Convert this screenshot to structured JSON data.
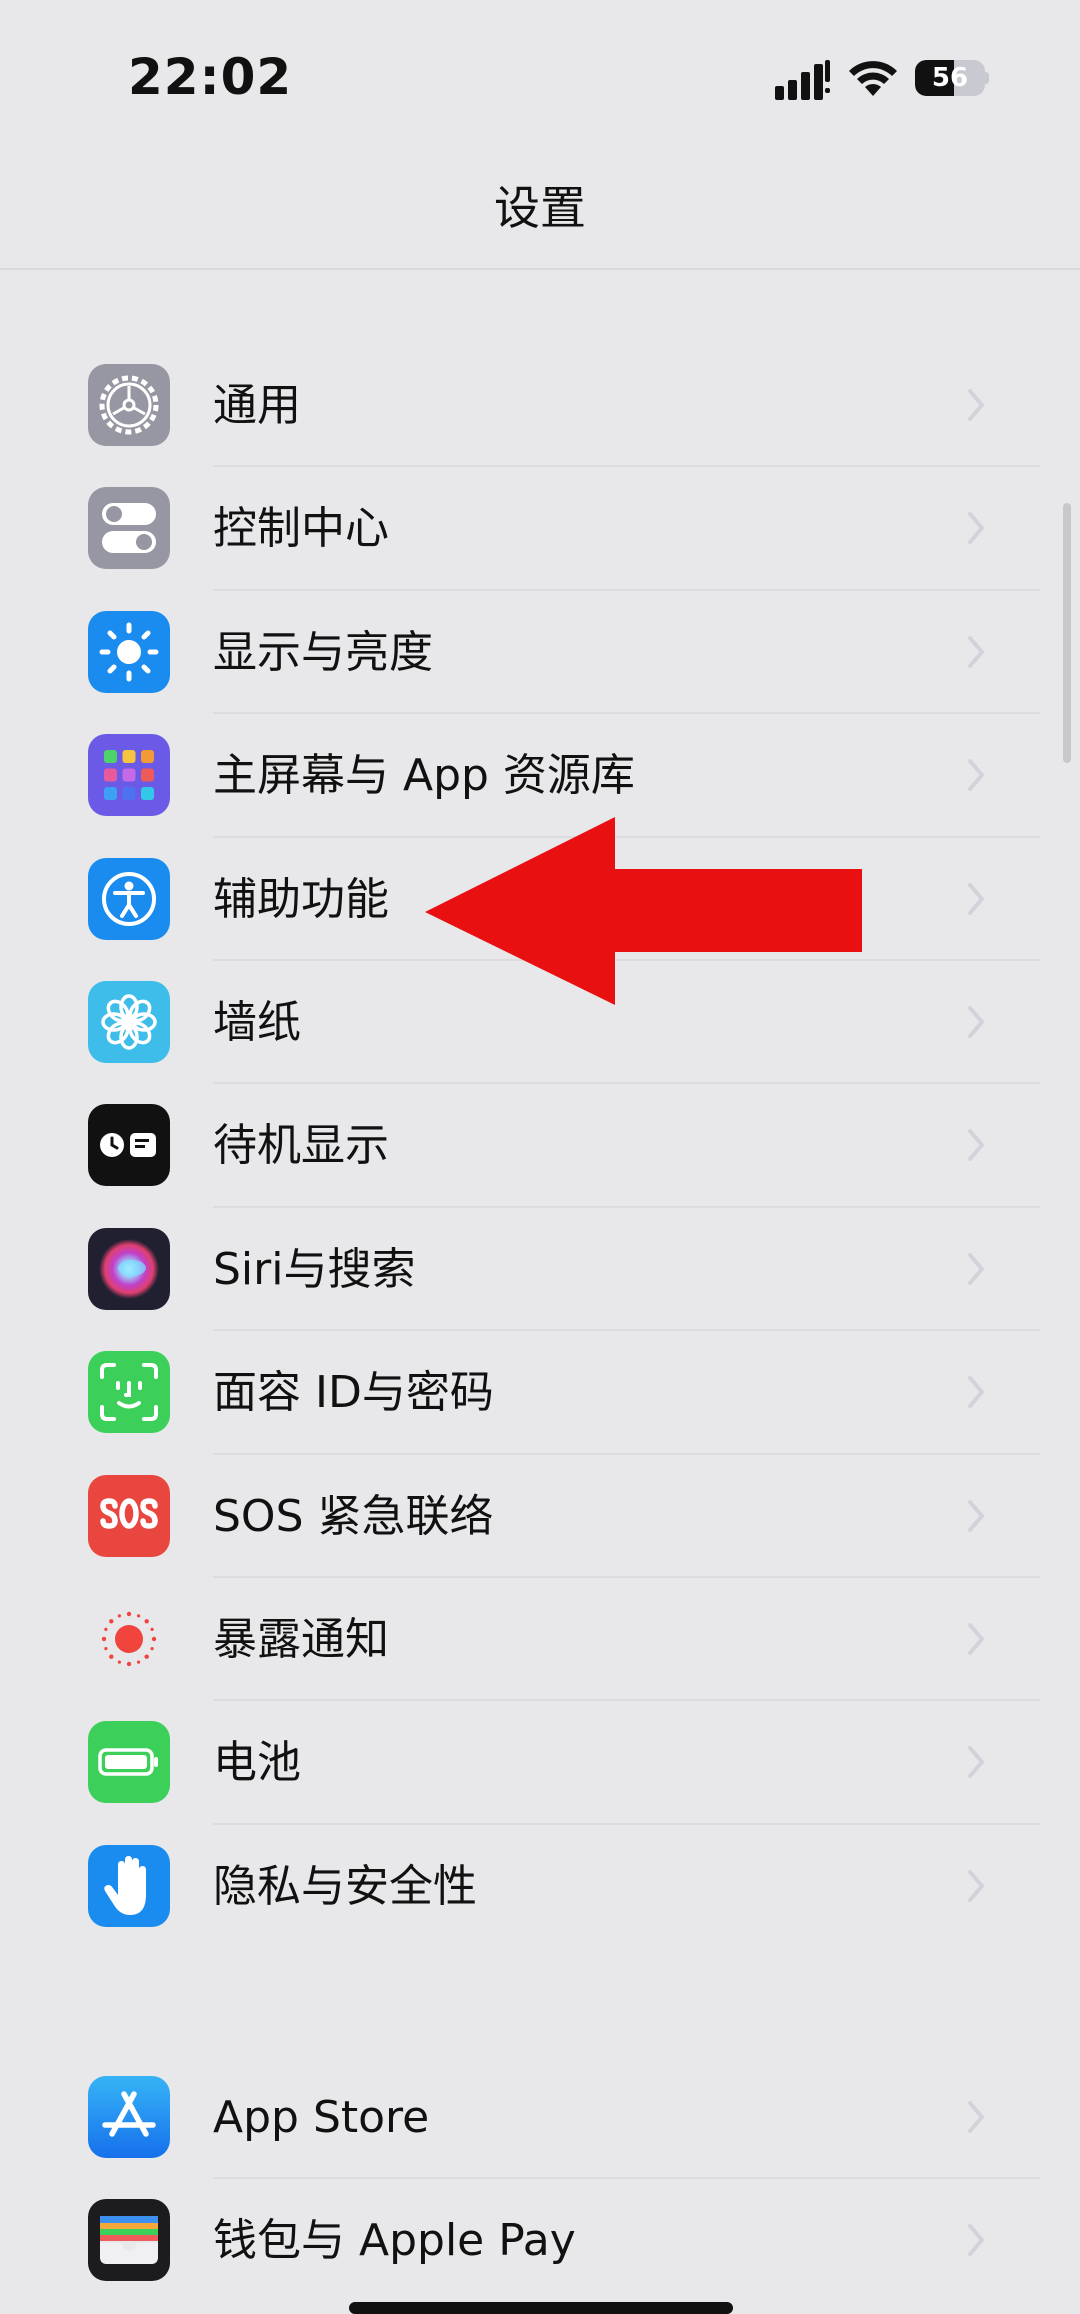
{
  "status_bar": {
    "time": "22:02",
    "battery_level": "56",
    "battery_fraction": 0.56
  },
  "nav": {
    "title": "设置"
  },
  "groups": [
    {
      "items": [
        {
          "label": "通用",
          "icon": "gear-icon",
          "color": "#8e8e98"
        },
        {
          "label": "控制中心",
          "icon": "toggles-icon",
          "color": "#8e8e98"
        },
        {
          "label": "显示与亮度",
          "icon": "sun-icon",
          "color": "#1a8cf0"
        },
        {
          "label": "主屏幕与 App 资源库",
          "icon": "app-grid-icon",
          "color": "#6a5ae6"
        },
        {
          "label": "辅助功能",
          "icon": "accessibility-icon",
          "color": "#1a8cf0"
        },
        {
          "label": "墙纸",
          "icon": "flower-icon",
          "color": "#3ebcea"
        },
        {
          "label": "待机显示",
          "icon": "standby-icon",
          "color": "#111111"
        },
        {
          "label": "Siri与搜索",
          "icon": "siri-icon",
          "color": "#202030"
        },
        {
          "label": "面容 ID与密码",
          "icon": "face-id-icon",
          "color": "#3ccf5a"
        },
        {
          "label": "SOS 紧急联络",
          "icon": "sos-icon",
          "color": "#e8463e"
        },
        {
          "label": "暴露通知",
          "icon": "exposure-icon",
          "color": "#ffffff"
        },
        {
          "label": "电池",
          "icon": "battery-icon",
          "color": "#3ccf5a"
        },
        {
          "label": "隐私与安全性",
          "icon": "hand-icon",
          "color": "#1a8cf0"
        }
      ]
    },
    {
      "items": [
        {
          "label": "App Store",
          "icon": "app-store-icon",
          "color": "#1a8cf0"
        },
        {
          "label": "钱包与 Apple Pay",
          "icon": "wallet-icon",
          "color": "#1c1c1e"
        }
      ]
    }
  ],
  "annotation": {
    "color": "#e81010"
  }
}
